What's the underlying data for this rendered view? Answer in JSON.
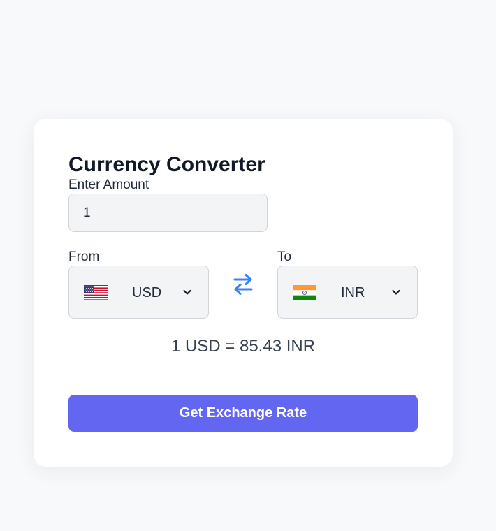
{
  "converter": {
    "title": "Currency Converter",
    "amount_label": "Enter Amount",
    "amount_value": "1",
    "from_label": "From",
    "to_label": "To",
    "from": {
      "code": "USD",
      "flag_icon": "us-flag-icon"
    },
    "to": {
      "code": "INR",
      "flag_icon": "india-flag-icon"
    },
    "swap_icon": "swap-arrows-icon",
    "result_text": "1 USD = 85.43 INR",
    "button_label": "Get Exchange Rate"
  },
  "colors": {
    "page_background": "#f8f9fb",
    "card_background": "#ffffff",
    "field_background": "#f3f4f6",
    "button": "#6366f1",
    "swap_icon": "#3b82f6"
  }
}
